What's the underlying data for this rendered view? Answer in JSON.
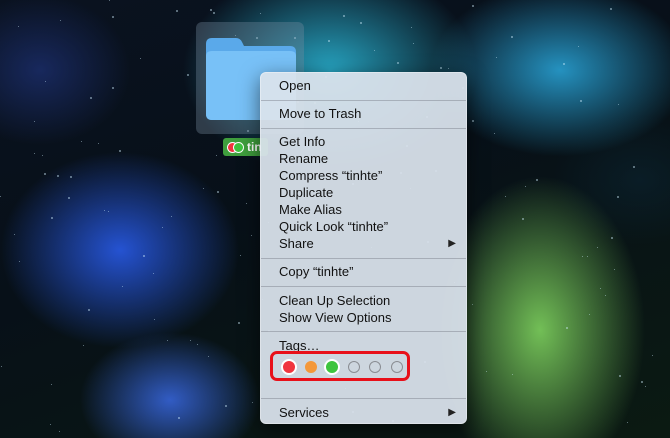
{
  "folder": {
    "name": "tinhte",
    "label_visible": "tin",
    "icon": "folder-icon"
  },
  "menu": {
    "groups": [
      [
        {
          "label": "Open"
        }
      ],
      [
        {
          "label": "Move to Trash"
        }
      ],
      [
        {
          "label": "Get Info"
        },
        {
          "label": "Rename"
        },
        {
          "label": "Compress “tinhte”"
        },
        {
          "label": "Duplicate"
        },
        {
          "label": "Make Alias"
        },
        {
          "label": "Quick Look “tinhte”"
        },
        {
          "label": "Share",
          "submenu": true
        }
      ],
      [
        {
          "label": "Copy “tinhte”"
        }
      ],
      [
        {
          "label": "Clean Up Selection"
        },
        {
          "label": "Show View Options"
        }
      ],
      [
        {
          "label": "Tags…"
        }
      ],
      [
        {
          "label": "Services",
          "submenu": true
        }
      ]
    ],
    "submenu_arrow": "▶"
  },
  "tags": [
    {
      "name": "red",
      "color": "#f0353f",
      "selected": true
    },
    {
      "name": "orange",
      "color": "#f4983a",
      "selected": false
    },
    {
      "name": "green",
      "color": "#3ec43e",
      "selected": true
    },
    {
      "name": "empty-1",
      "color": "",
      "selected": false
    },
    {
      "name": "empty-2",
      "color": "",
      "selected": false
    },
    {
      "name": "empty-3",
      "color": "",
      "selected": false
    }
  ],
  "colors": {
    "highlight": "#e8101a",
    "folder_blue": "#64b5f2",
    "label_green": "#3f9e3d"
  }
}
